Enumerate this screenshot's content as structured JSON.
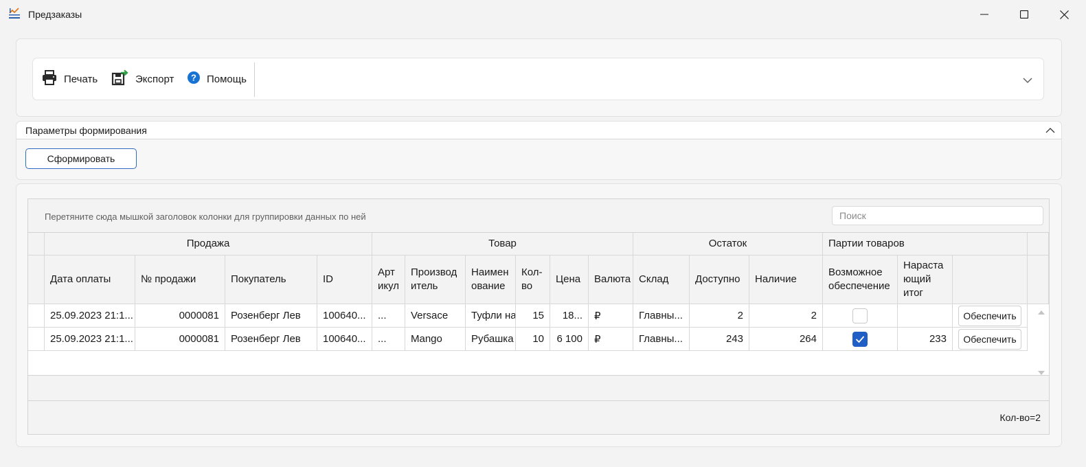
{
  "window": {
    "title": "Предзаказы"
  },
  "toolbar": {
    "print_label": "Печать",
    "export_label": "Экспорт",
    "help_label": "Помощь"
  },
  "params": {
    "title": "Параметры формирования",
    "form_button": "Сформировать"
  },
  "grid": {
    "group_hint": "Перетяните сюда мышкой заголовок колонки для группировки данных по ней",
    "search_placeholder": "Поиск",
    "bands": {
      "sale": "Продажа",
      "product": "Товар",
      "stock": "Остаток",
      "batches": "Партии товаров"
    },
    "columns": {
      "pay_date": "Дата оплаты",
      "sale_no": "№ продажи",
      "buyer": "Покупатель",
      "id": "ID",
      "article": "Арт икул",
      "maker": "Производ итель",
      "name": "Наимен ование",
      "qty": "Кол- во",
      "price": "Цена",
      "currency": "Валюта",
      "warehouse": "Склад",
      "available": "Доступно",
      "in_stock": "Наличие",
      "possible": "Возможное обеспечение",
      "cumulative": "Нараста ющий итог"
    },
    "rows": [
      {
        "pay_date": "25.09.2023 21:1...",
        "sale_no": "0000081",
        "buyer": "Розенберг Лев",
        "id": "100640...",
        "article": "...",
        "maker": "Versace",
        "name": "Туфли на",
        "qty": "15",
        "price": "18...",
        "currency": "₽",
        "warehouse": "Главны...",
        "available": "2",
        "in_stock": "2",
        "possible": false,
        "cumulative": "",
        "action": "Обеспечить"
      },
      {
        "pay_date": "25.09.2023 21:1...",
        "sale_no": "0000081",
        "buyer": "Розенберг Лев",
        "id": "100640...",
        "article": "...",
        "maker": "Mango",
        "name": "Рубашка",
        "qty": "10",
        "price": "6 100",
        "currency": "₽",
        "warehouse": "Главны...",
        "available": "243",
        "in_stock": "264",
        "possible": true,
        "cumulative": "233",
        "action": "Обеспечить"
      }
    ],
    "summary": "Кол-во=2"
  },
  "colors": {
    "accent": "#1f5fc6",
    "button_border": "#2f6bc1"
  }
}
